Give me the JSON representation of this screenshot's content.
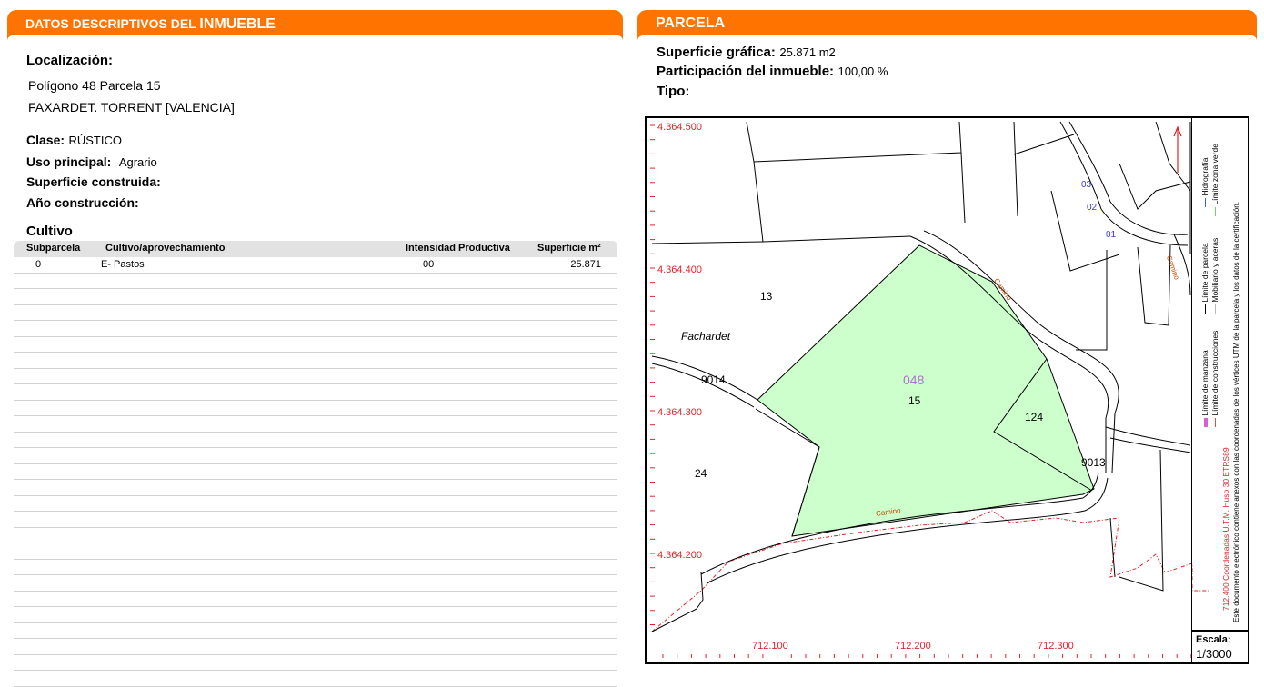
{
  "left_panel": {
    "title_prefix": "DATOS DESCRIPTIVOS DEL ",
    "title_strong": "INMUEBLE",
    "localizacion_label": "Localización:",
    "localizacion_line1": "Polígono 48 Parcela 15",
    "localizacion_line2": "FAXARDET. TORRENT [VALENCIA]",
    "clase_label": "Clase:",
    "clase_value": "RÚSTICO",
    "uso_label": "Uso principal:",
    "uso_value": "Agrario",
    "superficie_label": "Superficie construida:",
    "anio_label": "Año construcción:",
    "cultivo_title": "Cultivo",
    "table": {
      "headers": [
        "Subparcela",
        "Cultivo/aprovechamiento",
        "Intensidad Productiva",
        "Superficie m²"
      ],
      "rows": [
        [
          "0",
          "E- Pastos",
          "00",
          "25.871"
        ]
      ]
    }
  },
  "right_panel": {
    "title": "PARCELA",
    "superficie_grafica_label": "Superficie gráfica:",
    "superficie_grafica_value": "25.871 m2",
    "participacion_label": "Participación del inmueble:",
    "participacion_value": "100,00 %",
    "tipo_label": "Tipo:"
  },
  "map": {
    "y_coords": [
      "4.364.500",
      "4.364.400",
      "4.364.300",
      "4.364.200"
    ],
    "x_coords": [
      "712.100",
      "712.200",
      "712.300"
    ],
    "parcel_numbers": [
      "13",
      "15",
      "24",
      "124",
      "9014",
      "9013"
    ],
    "poligono": "048",
    "place_name": "Fachardet",
    "road_label": "Camino",
    "small_numbers": [
      "03",
      "02",
      "01"
    ],
    "legend": {
      "limite_manzana": "Límite de manzana",
      "limite_construcciones": "Límite de construcciones",
      "limite_parcela": "Límite de parcela",
      "mobiliario": "Mobiliario y aceras",
      "hidrografia": "Hidrografía",
      "zona_verde": "Límite zona verde",
      "coords_note": "712,400 Coordenadas U.T.M. Huso 30 ETRS89",
      "doc_note": "Este documento electrónico contiene anexos con las coordenadas de los vértices UTM de la parcela y los datos de la certificación."
    },
    "escala_label": "Escala:",
    "escala_value": "1/3000",
    "colors": {
      "parcel_fill": "#ccffcc",
      "coord_red": "#e0242a",
      "poligono_purple": "#b36fd6",
      "small_blue": "#3a3ad0"
    }
  }
}
